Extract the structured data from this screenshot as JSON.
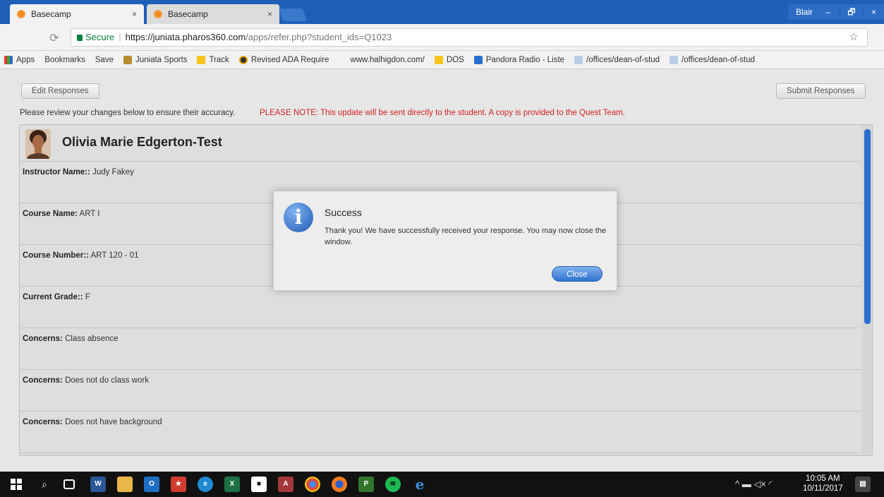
{
  "browser": {
    "tabs": [
      {
        "label": "Basecamp",
        "close": "×"
      },
      {
        "label": "Basecamp",
        "close": "×"
      }
    ],
    "user": "Blair",
    "window_controls": {
      "minimize": "–",
      "maximize": "🗗",
      "close": "×"
    },
    "address": {
      "secure_label": "Secure",
      "host": "https://juniata.pharos360.com",
      "path": "/apps/refer.php?student_ids=Q1023"
    },
    "bookmarks": [
      {
        "label": "Apps",
        "icon": "apps-grid-icon"
      },
      {
        "label": "Bookmarks",
        "icon": "none"
      },
      {
        "label": "Save",
        "icon": "none"
      },
      {
        "label": "Juniata Sports",
        "icon": "juniata-icon"
      },
      {
        "label": "Track",
        "icon": "folder-icon"
      },
      {
        "label": "Revised ADA Require",
        "icon": "record-icon"
      },
      {
        "label": "www.halhigdon.com/",
        "icon": "none"
      },
      {
        "label": "DOS",
        "icon": "folder-icon"
      },
      {
        "label": "Pandora Radio - Liste",
        "icon": "pandora-icon"
      },
      {
        "label": "/offices/dean-of-stud",
        "icon": "page-icon"
      },
      {
        "label": "/offices/dean-of-stud",
        "icon": "page-icon"
      }
    ]
  },
  "page": {
    "edit_button": "Edit Responses",
    "submit_button": "Submit Responses",
    "review_text": "Please review your changes below to ensure their accuracy.",
    "note_text": "PLEASE NOTE: This update will be sent directly to the student. A copy is provided to the Quest Team.",
    "student_name": "Olivia Marie Edgerton-Test",
    "rows": [
      {
        "label": "Instructor Name::",
        "value": "Judy Fakey"
      },
      {
        "label": "Course Name:",
        "value": "ART I"
      },
      {
        "label": "Course Number::",
        "value": "ART 120 - 01"
      },
      {
        "label": "Current Grade::",
        "value": "F"
      },
      {
        "label": "Concerns:",
        "value": "Class absence"
      },
      {
        "label": "Concerns:",
        "value": "Does not do class work"
      },
      {
        "label": "Concerns:",
        "value": "Does not have background"
      }
    ]
  },
  "dialog": {
    "icon_glyph": "i",
    "title": "Success",
    "message": "Thank you! We have successfully received your response. You may now close the window.",
    "close_label": "Close"
  },
  "taskbar": {
    "time": "10:05 AM",
    "date": "10/11/2017",
    "colors": {
      "accent": "#1f5fb8",
      "note": "#d21f1f",
      "scroll": "#2a6fd0"
    }
  }
}
